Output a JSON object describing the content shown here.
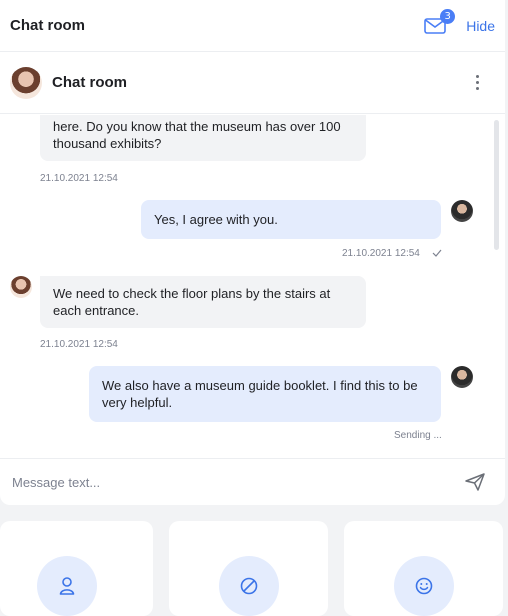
{
  "topbar": {
    "title": "Chat room",
    "mail_badge_count": "3",
    "hide_label": "Hide"
  },
  "chat_header": {
    "name": "Chat room"
  },
  "messages": [
    {
      "direction": "in",
      "text": "here. Do you know that the museum has over 100 thousand exhibits?",
      "time": "21.10.2021 12:54"
    },
    {
      "direction": "out",
      "text": "Yes, I agree with you.",
      "time": "21.10.2021 12:54",
      "status": "read"
    },
    {
      "direction": "in",
      "text": "We need to check the floor plans by the stairs at each entrance.",
      "time": "21.10.2021 12:54"
    },
    {
      "direction": "out",
      "text": "We also have a museum guide booklet. I find this to be very helpful.",
      "status_text": "Sending ..."
    }
  ],
  "composer": {
    "placeholder": "Message text..."
  },
  "action_cards": [
    {
      "icon": "user-icon"
    },
    {
      "icon": "block-icon"
    },
    {
      "icon": "smile-icon"
    }
  ],
  "colors": {
    "accent": "#3b74e8",
    "outgoing_bubble": "#e4ecfd",
    "incoming_bubble": "#f2f3f5",
    "background": "#f2f3f5"
  }
}
